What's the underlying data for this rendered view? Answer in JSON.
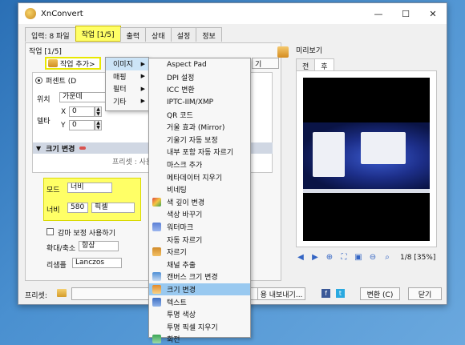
{
  "window": {
    "title": "XnConvert"
  },
  "titlebar": {
    "min": "—",
    "max": "☐",
    "close": "✕"
  },
  "tabs": [
    {
      "label": "입력: 8 파일"
    },
    {
      "label": "작업 [1/5]"
    },
    {
      "label": "출력"
    },
    {
      "label": "상태"
    },
    {
      "label": "설정"
    },
    {
      "label": "정보"
    }
  ],
  "left": {
    "title": "작업 [1/5]",
    "add_button": "작업 추가>",
    "partial_button": "기",
    "radio_label": "퍼센트 (D",
    "position_label": "위치",
    "position_value": "가운데",
    "delta_label": "델타",
    "x_label": "X",
    "x_value": "0",
    "y_label": "Y",
    "y_value": "0",
    "section_title": "크기 변경",
    "preset_label": "프리셋 : 사용자 정의",
    "mode_label": "모드",
    "mode_value": "너비",
    "width_label": "너비",
    "width_value": "580",
    "unit_value": "픽셀",
    "gamma_label": "감마 보정 사용하기",
    "zoom_label": "확대/축소",
    "zoom_value": "항상",
    "resample_label": "리샘플",
    "resample_value": "Lanczos"
  },
  "bottom": {
    "preset_label": "프리셋:",
    "export_button": "용 내보내기...",
    "convert_button": "변환 (C)",
    "close_button": "닫기"
  },
  "preview": {
    "title": "미리보기",
    "tabs": [
      "전",
      "후"
    ],
    "page_info": "1/8 [35%]"
  },
  "menu1": {
    "items": [
      {
        "label": "이미지",
        "has_sub": true
      },
      {
        "label": "매핑",
        "has_sub": true
      },
      {
        "label": "필터",
        "has_sub": true
      },
      {
        "label": "기타",
        "has_sub": true
      }
    ]
  },
  "menu2": {
    "items": [
      {
        "label": "Aspect Pad",
        "icon": ""
      },
      {
        "label": "DPI 설정",
        "icon": ""
      },
      {
        "label": "ICC 변환",
        "icon": ""
      },
      {
        "label": "IPTC-IIM/XMP",
        "icon": ""
      },
      {
        "label": "QR 코드",
        "icon": ""
      },
      {
        "label": "거울 효과 (Mirror)",
        "icon": ""
      },
      {
        "label": "기울기 자동 보정",
        "icon": ""
      },
      {
        "label": "내부 포함 자동 자르기",
        "icon": ""
      },
      {
        "label": "마스크 추가",
        "icon": ""
      },
      {
        "label": "메타데이터 지우기",
        "icon": ""
      },
      {
        "label": "비네팅",
        "icon": ""
      },
      {
        "label": "색 깊이 변경",
        "icon": "color-depth-icon"
      },
      {
        "label": "색상 바꾸기",
        "icon": ""
      },
      {
        "label": "워터마크",
        "icon": "watermark-icon"
      },
      {
        "label": "자동 자르기",
        "icon": ""
      },
      {
        "label": "자르기",
        "icon": "crop-icon"
      },
      {
        "label": "채널 추출",
        "icon": ""
      },
      {
        "label": "캔버스 크기 변경",
        "icon": "canvas-size-icon"
      },
      {
        "label": "크기 변경",
        "icon": "resize-icon",
        "highlighted": true
      },
      {
        "label": "텍스트",
        "icon": "text-icon"
      },
      {
        "label": "투명 색상",
        "icon": ""
      },
      {
        "label": "투명 픽셀 지우기",
        "icon": ""
      },
      {
        "label": "회전",
        "icon": "rotate-icon"
      }
    ]
  }
}
